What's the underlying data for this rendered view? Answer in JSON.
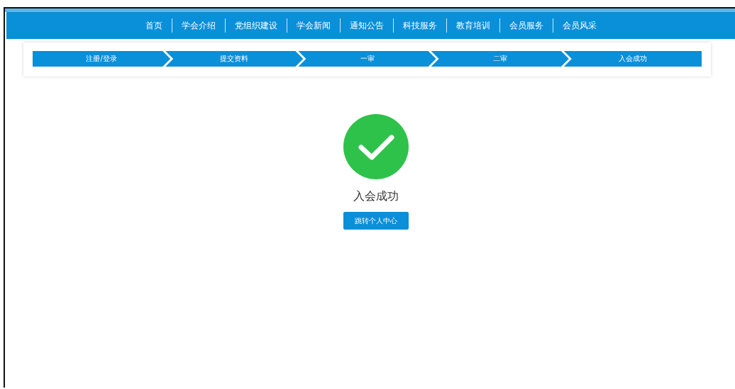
{
  "nav": {
    "items": [
      "首页",
      "学会介绍",
      "党组织建设",
      "学会新闻",
      "通知公告",
      "科技服务",
      "教育培训",
      "会员服务",
      "会员风采"
    ]
  },
  "steps": [
    "注册/登录",
    "提交资料",
    "一审",
    "二审",
    "入会成功"
  ],
  "result": {
    "title": "入会成功",
    "button": "跳转个人中心"
  }
}
